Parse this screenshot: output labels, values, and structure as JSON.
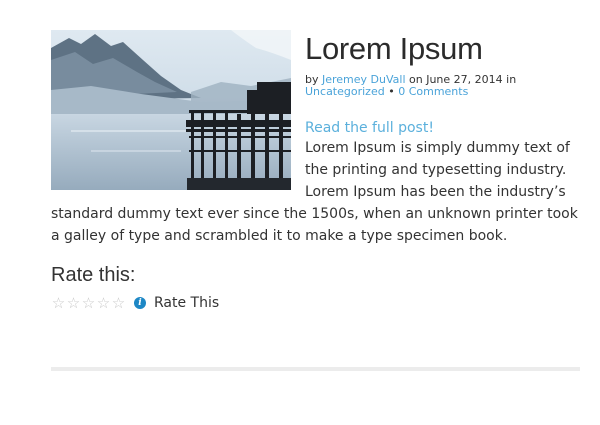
{
  "post": {
    "title": "Lorem Ipsum",
    "meta": {
      "by": "by ",
      "author": "Jeremey DuVall",
      "on_date": " on June 27, 2014",
      "in": " in ",
      "category": "Uncategorized",
      "separator": " • ",
      "comments": "0 Comments"
    },
    "read_more": "Read the full post!",
    "excerpt": "Lorem Ipsum is simply dummy text of the printing and typesetting industry. Lorem Ipsum has been the industry’s standard dummy text ever since the 1500s, when an unknown printer took a galley of type and scrambled it to make a type specimen book."
  },
  "rating": {
    "heading": "Rate this:",
    "stars_total": 5,
    "stars_filled": 0,
    "star_glyph": "☆",
    "info_glyph": "i",
    "label": "Rate This"
  },
  "colors": {
    "link": "#4aa3d9",
    "info_icon": "#1d87c5"
  }
}
